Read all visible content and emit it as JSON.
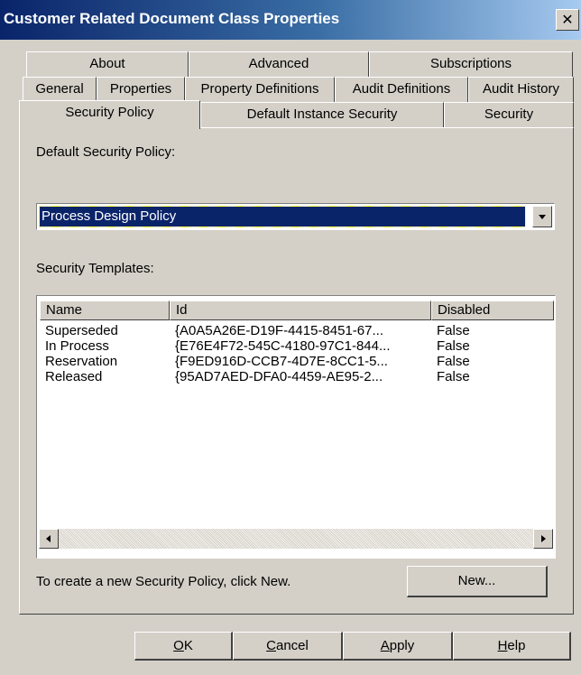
{
  "window": {
    "title": "Customer Related Document Class Properties",
    "close_glyph": "✕"
  },
  "tabs": {
    "row1": [
      "About",
      "Advanced",
      "Subscriptions"
    ],
    "row2": [
      "General",
      "Properties",
      "Property Definitions",
      "Audit Definitions",
      "Audit History"
    ],
    "row3": [
      "Security Policy",
      "Default Instance Security",
      "Security"
    ],
    "active": "Security Policy"
  },
  "security_policy": {
    "default_label": "Default Security Policy:",
    "selected_policy": "Process Design Policy",
    "templates_label": "Security Templates:",
    "columns": [
      "Name",
      "Id",
      "Disabled"
    ],
    "rows": [
      {
        "name": "Superseded",
        "id": "{A0A5A26E-D19F-4415-8451-67...",
        "disabled": "False"
      },
      {
        "name": "In Process",
        "id": "{E76E4F72-545C-4180-97C1-844...",
        "disabled": "False"
      },
      {
        "name": "Reservation",
        "id": "{F9ED916D-CCB7-4D7E-8CC1-5...",
        "disabled": "False"
      },
      {
        "name": "Released",
        "id": "{95AD7AED-DFA0-4459-AE95-2...",
        "disabled": "False"
      }
    ],
    "hint_text": "To create a new Security Policy, click New.",
    "new_button": "New..."
  },
  "buttons": {
    "ok": {
      "mnemonic": "O",
      "rest": "K"
    },
    "cancel": {
      "mnemonic": "C",
      "rest": "ancel"
    },
    "apply": {
      "mnemonic": "A",
      "rest": "pply"
    },
    "help": {
      "mnemonic": "H",
      "rest": "elp"
    }
  },
  "icons": {
    "close": "close-icon",
    "dropdown": "chevron-down-icon",
    "scroll_left": "scroll-left-icon",
    "scroll_right": "scroll-right-icon"
  },
  "colors": {
    "title_start": "#0a246a",
    "title_end": "#a6caf0",
    "selection": "#0a246a",
    "face": "#d4d0c8"
  }
}
